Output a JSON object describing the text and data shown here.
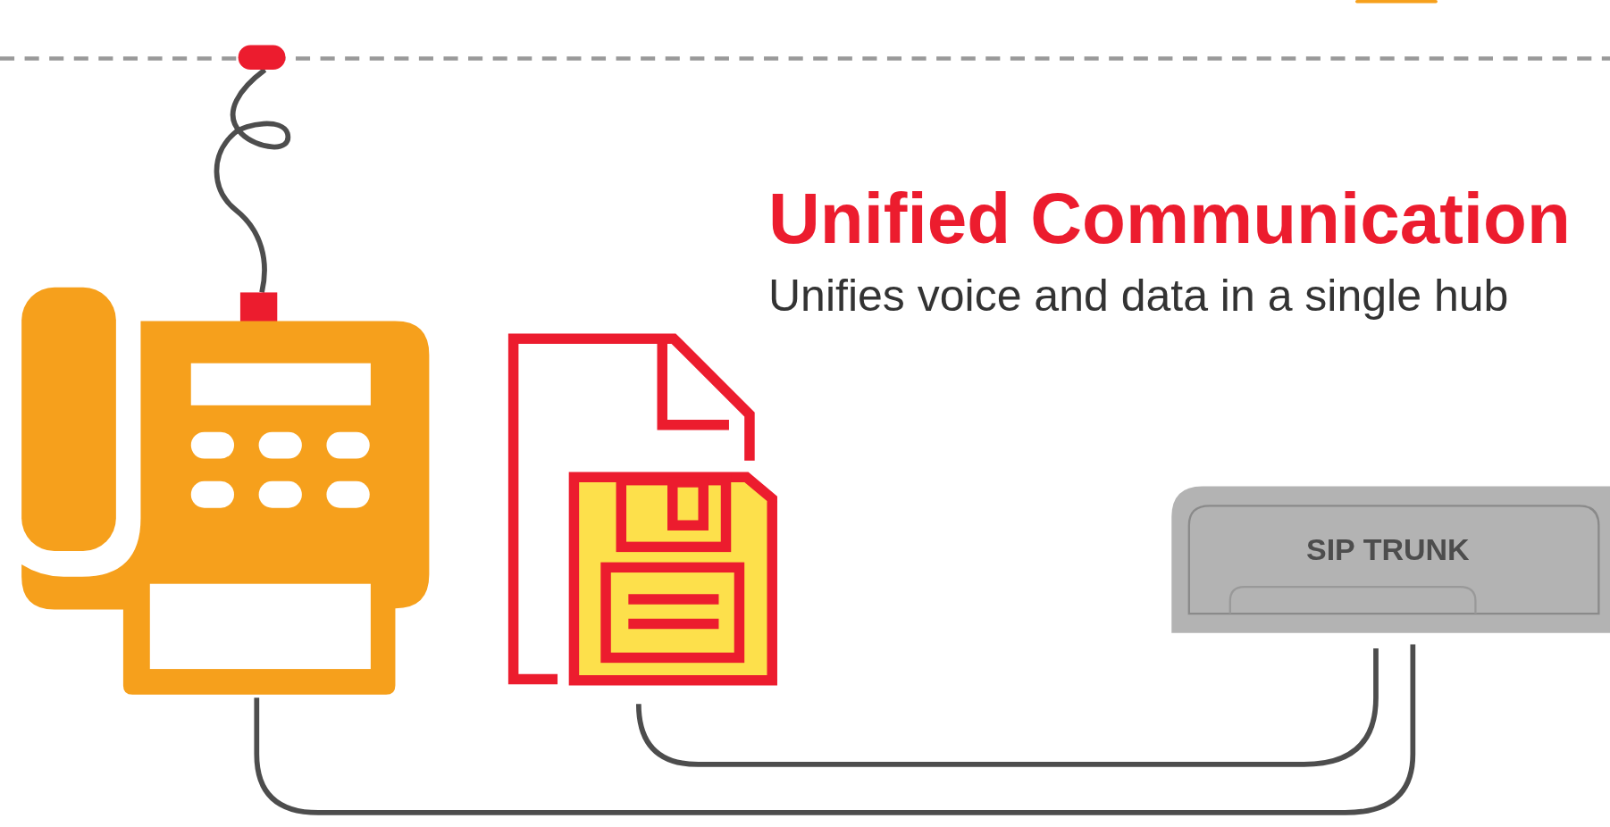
{
  "heading": {
    "title": "Unified Communication",
    "subtitle": "Unifies voice and data in a single hub"
  },
  "device": {
    "label": "SIP TRUNK"
  }
}
